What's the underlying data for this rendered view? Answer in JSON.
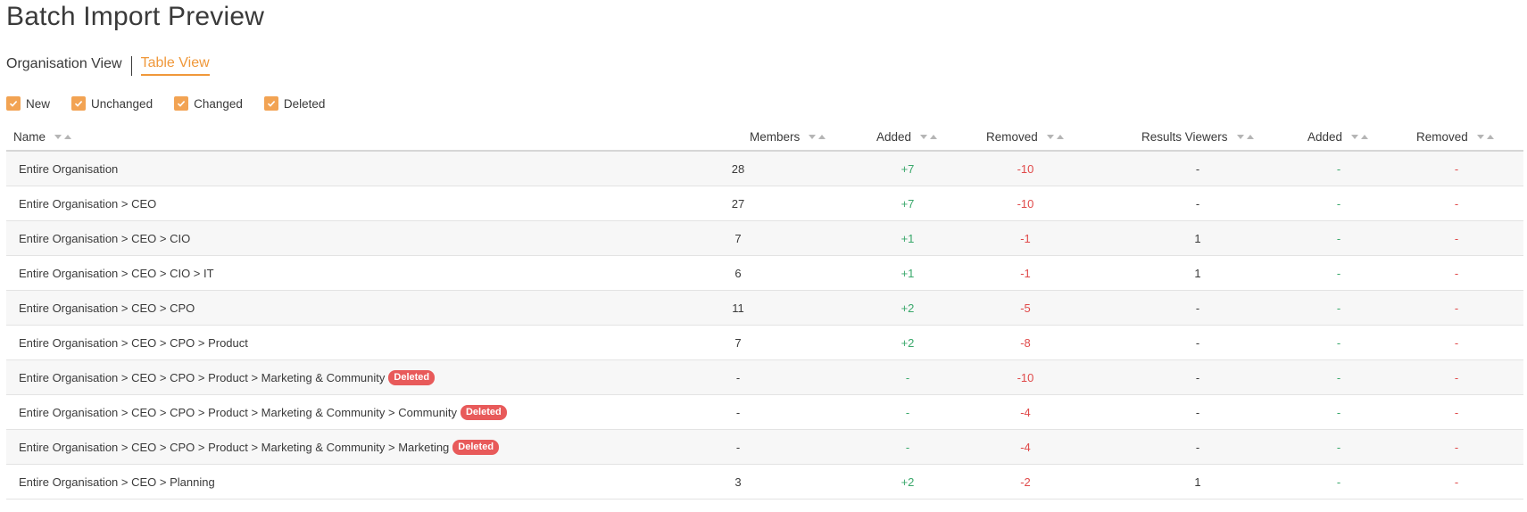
{
  "page": {
    "title": "Batch Import Preview"
  },
  "tabs": [
    {
      "label": "Organisation View",
      "active": false
    },
    {
      "label": "Table View",
      "active": true
    }
  ],
  "filters": [
    {
      "label": "New",
      "checked": true
    },
    {
      "label": "Unchanged",
      "checked": true
    },
    {
      "label": "Changed",
      "checked": true
    },
    {
      "label": "Deleted",
      "checked": true
    }
  ],
  "colors": {
    "accent": "#f0983a",
    "checkbox": "#f2a353",
    "positive": "#3aa86b",
    "negative": "#e04a4a",
    "badge": "#e85a5a"
  },
  "table": {
    "headers": {
      "name": "Name",
      "members": "Members",
      "added": "Added",
      "removed": "Removed",
      "results_viewers": "Results Viewers",
      "added2": "Added",
      "removed2": "Removed"
    },
    "rows": [
      {
        "name": "Entire Organisation",
        "badge": "",
        "members": "28",
        "added": "+7",
        "removed": "-10",
        "results_viewers": "-",
        "added2": "-",
        "removed2": "-"
      },
      {
        "name": "Entire Organisation > CEO",
        "badge": "",
        "members": "27",
        "added": "+7",
        "removed": "-10",
        "results_viewers": "-",
        "added2": "-",
        "removed2": "-"
      },
      {
        "name": "Entire Organisation > CEO > CIO",
        "badge": "",
        "members": "7",
        "added": "+1",
        "removed": "-1",
        "results_viewers": "1",
        "added2": "-",
        "removed2": "-"
      },
      {
        "name": "Entire Organisation > CEO > CIO > IT",
        "badge": "",
        "members": "6",
        "added": "+1",
        "removed": "-1",
        "results_viewers": "1",
        "added2": "-",
        "removed2": "-"
      },
      {
        "name": "Entire Organisation > CEO > CPO",
        "badge": "",
        "members": "11",
        "added": "+2",
        "removed": "-5",
        "results_viewers": "-",
        "added2": "-",
        "removed2": "-"
      },
      {
        "name": "Entire Organisation > CEO > CPO > Product",
        "badge": "",
        "members": "7",
        "added": "+2",
        "removed": "-8",
        "results_viewers": "-",
        "added2": "-",
        "removed2": "-"
      },
      {
        "name": "Entire Organisation > CEO > CPO > Product > Marketing & Community",
        "badge": "Deleted",
        "members": "-",
        "added": "-",
        "removed": "-10",
        "results_viewers": "-",
        "added2": "-",
        "removed2": "-"
      },
      {
        "name": "Entire Organisation > CEO > CPO > Product > Marketing & Community > Community",
        "badge": "Deleted",
        "members": "-",
        "added": "-",
        "removed": "-4",
        "results_viewers": "-",
        "added2": "-",
        "removed2": "-"
      },
      {
        "name": "Entire Organisation > CEO > CPO > Product > Marketing & Community > Marketing",
        "badge": "Deleted",
        "members": "-",
        "added": "-",
        "removed": "-4",
        "results_viewers": "-",
        "added2": "-",
        "removed2": "-"
      },
      {
        "name": "Entire Organisation > CEO > Planning",
        "badge": "",
        "members": "3",
        "added": "+2",
        "removed": "-2",
        "results_viewers": "1",
        "added2": "-",
        "removed2": "-"
      }
    ]
  }
}
